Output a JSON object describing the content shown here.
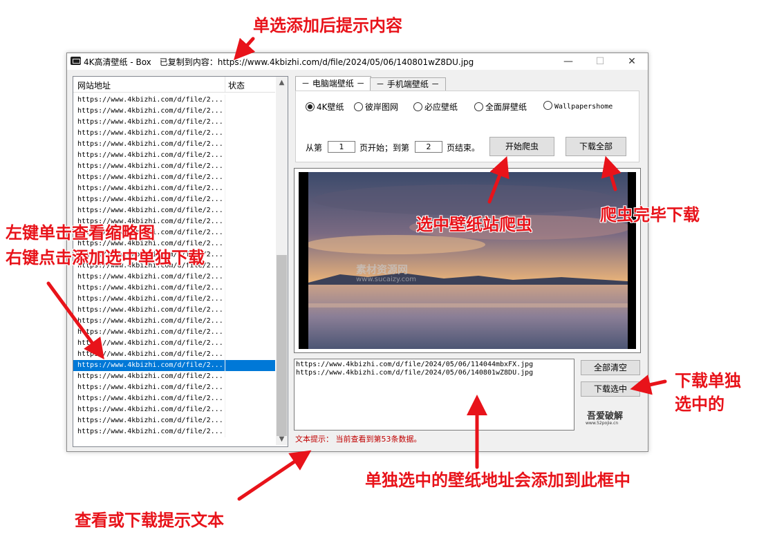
{
  "window": {
    "title": "4K高清壁纸 - Box　已复制到内容：https://www.4kbizhi.com/d/file/2024/05/06/140801wZ8DU.jpg",
    "minimize": "—",
    "maximize": "☐",
    "close": "✕"
  },
  "list": {
    "col_url": "网站地址",
    "col_state": "状态",
    "rows": [
      "https://www.4kbizhi.com/d/file/2...",
      "https://www.4kbizhi.com/d/file/2...",
      "https://www.4kbizhi.com/d/file/2...",
      "https://www.4kbizhi.com/d/file/2...",
      "https://www.4kbizhi.com/d/file/2...",
      "https://www.4kbizhi.com/d/file/2...",
      "https://www.4kbizhi.com/d/file/2...",
      "https://www.4kbizhi.com/d/file/2...",
      "https://www.4kbizhi.com/d/file/2...",
      "https://www.4kbizhi.com/d/file/2...",
      "https://www.4kbizhi.com/d/file/2...",
      "https://www.4kbizhi.com/d/file/2...",
      "https://www.4kbizhi.com/d/file/2...",
      "https://www.4kbizhi.com/d/file/2...",
      "https://www.4kbizhi.com/d/file/2...",
      "https://www.4kbizhi.com/d/file/2...",
      "https://www.4kbizhi.com/d/file/2...",
      "https://www.4kbizhi.com/d/file/2...",
      "https://www.4kbizhi.com/d/file/2...",
      "https://www.4kbizhi.com/d/file/2...",
      "https://www.4kbizhi.com/d/file/2...",
      "https://www.4kbizhi.com/d/file/2...",
      "https://www.4kbizhi.com/d/file/2...",
      "https://www.4kbizhi.com/d/file/2...",
      "https://www.4kbizhi.com/d/file/2...",
      "https://www.4kbizhi.com/d/file/2...",
      "https://www.4kbizhi.com/d/file/2...",
      "https://www.4kbizhi.com/d/file/2...",
      "https://www.4kbizhi.com/d/file/2...",
      "https://www.4kbizhi.com/d/file/2...",
      "https://www.4kbizhi.com/d/file/2..."
    ],
    "selected_index": 24,
    "scroll_up": "▲",
    "scroll_down": "▼"
  },
  "tabs": [
    "电脑端壁纸",
    "手机端壁纸"
  ],
  "sources": [
    "4K壁纸",
    "彼岸图网",
    "必应壁纸",
    "全面屏壁纸",
    "Wallpapershome"
  ],
  "selected_source": 0,
  "pages": {
    "from_label": "从第",
    "from_value": "1",
    "mid_label": "页开始；到第",
    "to_value": "2",
    "end_label": "页结束。"
  },
  "buttons": {
    "start_crawl": "开始爬虫",
    "download_all": "下载全部",
    "clear_all": "全部清空",
    "download_selected": "下载选中"
  },
  "selected_urls": [
    "https://www.4kbizhi.com/d/file/2024/05/06/114044mbxFX.jpg",
    "https://www.4kbizhi.com/d/file/2024/05/06/140801wZ8DU.jpg"
  ],
  "status_text": "文本提示：  当前查看到第53条数据。",
  "watermark": {
    "line1": "素材资源网",
    "line2": "www.sucaizy.com"
  },
  "logo_text": "吾爱破解",
  "logo_sub": "www.52pojie.cn",
  "annotations": {
    "top": "单选添加后提示内容",
    "left1": "左键单击查看缩略图",
    "left2": "右键点击添加选中单独下载",
    "crawl": "选中壁纸站爬虫",
    "download": "爬虫完毕下载",
    "dl_sel1": "下载单独",
    "dl_sel2": "选中的",
    "box": "单独选中的壁纸地址会添加到此框中",
    "bottom": "查看或下载提示文本"
  },
  "colors": {
    "annotation": "#e8131a",
    "selection": "#0078d7",
    "status": "#c00000"
  }
}
